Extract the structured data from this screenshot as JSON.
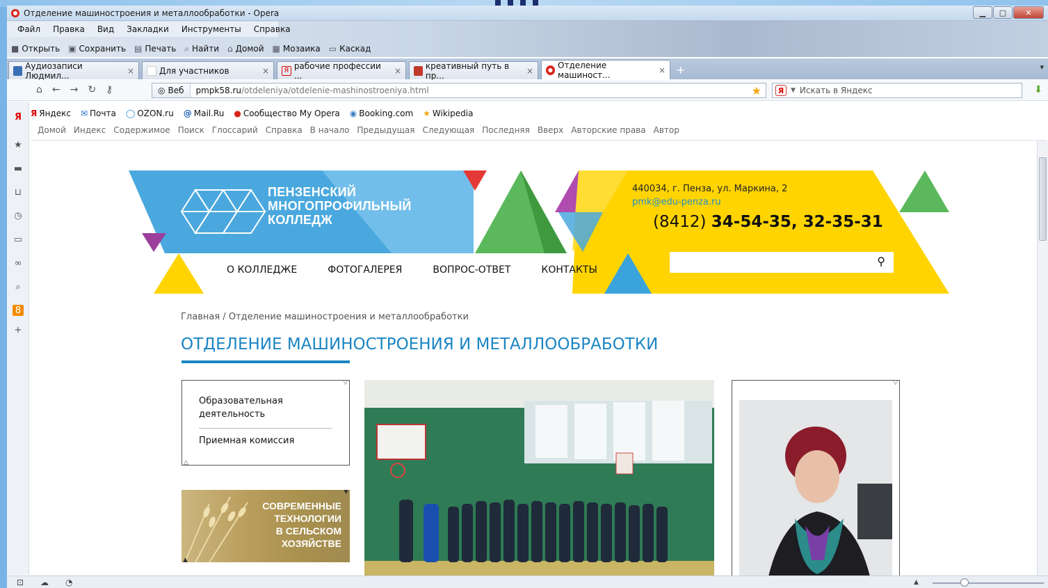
{
  "window": {
    "title": "Отделение машиностроения и металлообработки - Opera"
  },
  "menu": [
    "Файл",
    "Правка",
    "Вид",
    "Закладки",
    "Инструменты",
    "Справка"
  ],
  "toolbar": {
    "open": "Открыть",
    "save": "Сохранить",
    "print": "Печать",
    "find": "Найти",
    "home": "Домой",
    "mosaic": "Мозаика",
    "cascade": "Каскад"
  },
  "tabs": [
    {
      "label": "Аудиозаписи Людмил...",
      "icon_color": "#3b6fb6"
    },
    {
      "label": "Для участников",
      "icon_color": "#ffffff"
    },
    {
      "label": "рабочие профессии ...",
      "icon_color": "#d00000"
    },
    {
      "label": "креативный путь в пр...",
      "icon_color": "#c0392b"
    },
    {
      "label": "Отделение машиност...",
      "icon_color": "#d9261c"
    }
  ],
  "address": {
    "web_label": "Веб",
    "url_host": "pmpk58.ru",
    "url_path": "/otdeleniya/otdelenie-mashinostroeniya.html",
    "search_placeholder": "Искать в Яндекс"
  },
  "bookmarks": [
    "Яндекс",
    "Почта",
    "OZON.ru",
    "Mail.Ru",
    "Сообщество My Opera",
    "Booking.com",
    "Wikipedia"
  ],
  "nav_links": [
    "Домой",
    "Индекс",
    "Содержимое",
    "Поиск",
    "Глоссарий",
    "Справка",
    "В начало",
    "Предыдущая",
    "Следующая",
    "Последняя",
    "Вверх",
    "Авторские права",
    "Автор"
  ],
  "site": {
    "college_line1": "ПЕНЗЕНСКИЙ",
    "college_line2": "МНОГОПРОФИЛЬНЫЙ",
    "college_line3": "КОЛЛЕДЖ",
    "address": "440034, г. Пенза, ул. Маркина, 2",
    "email": "pmk@edu-penza.ru",
    "phone_code": "(8412)",
    "phone_numbers": "34-54-35, 32-35-31",
    "main_nav": [
      "О КОЛЛЕДЖЕ",
      "ФОТОГАЛЕРЕЯ",
      "ВОПРОС-ОТВЕТ",
      "КОНТАКТЫ"
    ],
    "breadcrumb_home": "Главная",
    "breadcrumb_sep": "/",
    "breadcrumb_current": "Отделение машиностроения и металлообработки",
    "page_title": "ОТДЕЛЕНИЕ МАШИНОСТРОЕНИЯ И МЕТАЛЛООБРАБОТКИ",
    "side_items": [
      "Образовательная деятельность",
      "Приемная комиссия"
    ],
    "banner_lines": [
      "СОВРЕМЕННЫЕ",
      "ТЕХНОЛОГИИ",
      "В СЕЛЬСКОМ",
      "ХОЗЯЙСТВЕ"
    ]
  },
  "colors": {
    "accent_blue": "#1a85c3",
    "logo_blue": "#4aa8de",
    "yellow": "#ffd400",
    "green": "#5cb85c"
  }
}
